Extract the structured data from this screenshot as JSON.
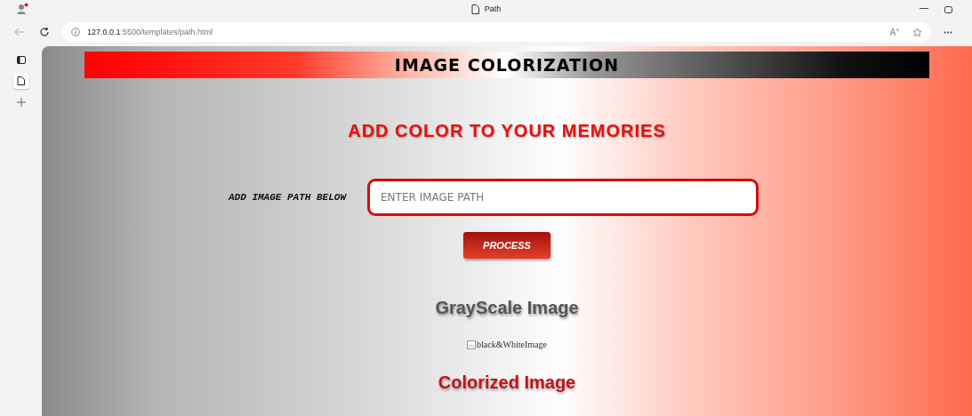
{
  "window": {
    "title": "Path"
  },
  "address_bar": {
    "host": "127.0.0.1",
    "path": ":5500/templates/path.html"
  },
  "page": {
    "banner": "IMAGE COLORIZATION",
    "headline": "ADD COLOR TO YOUR MEMORIES",
    "path_label": "ADD IMAGE PATH BELOW",
    "path_field": {
      "placeholder": "ENTER IMAGE PATH"
    },
    "process_button": "PROCESS",
    "grayscale_heading": "GrayScale Image",
    "grayscale_image_alt": "black&WhiteImage",
    "colorized_heading": "Colorized Image"
  }
}
